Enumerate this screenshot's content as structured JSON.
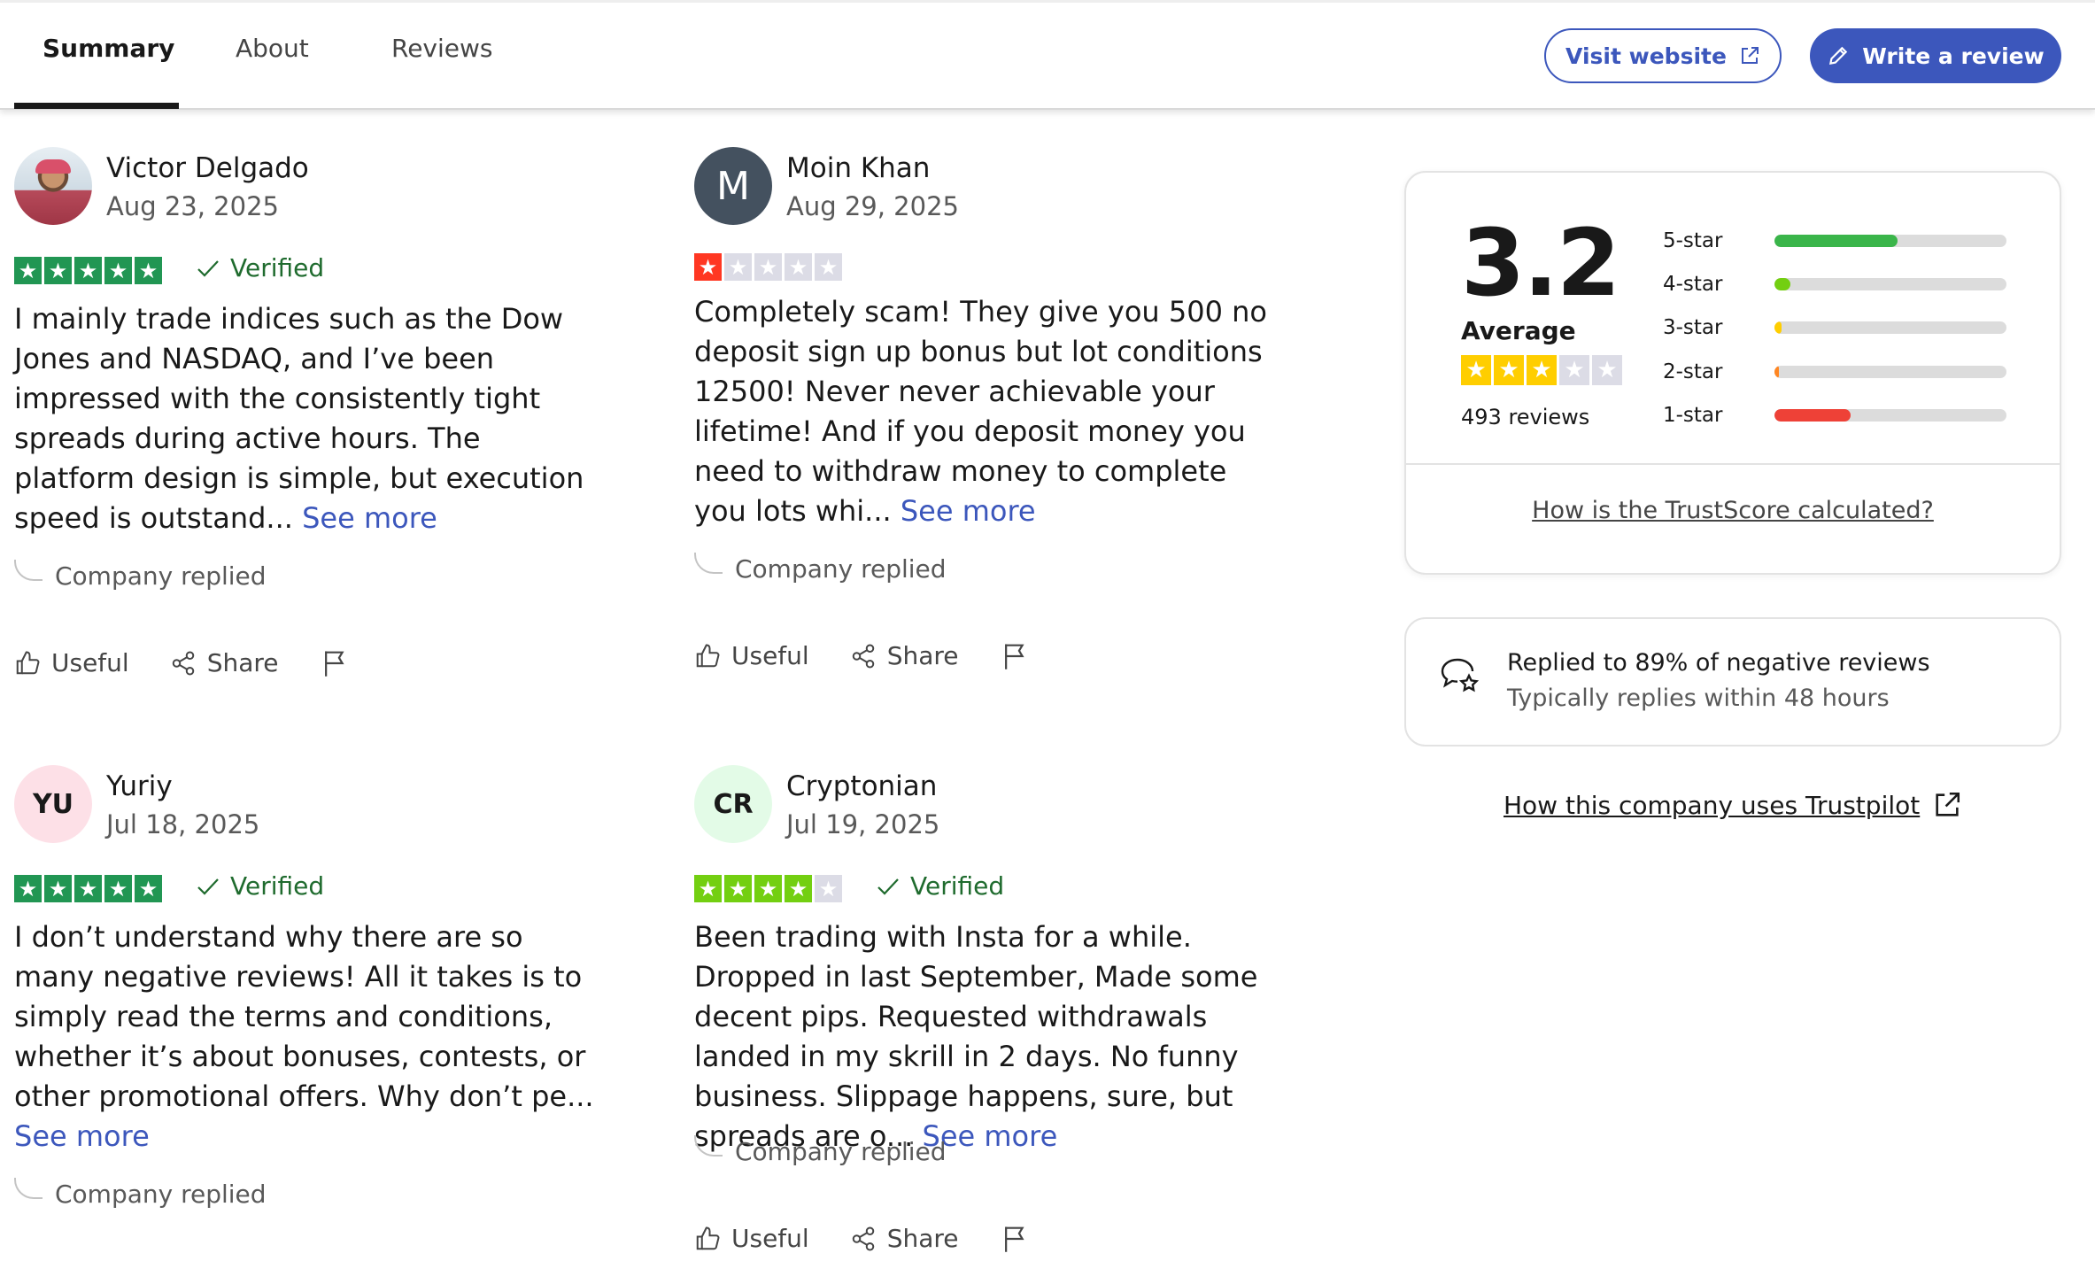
{
  "tabs": [
    {
      "label": "Summary",
      "active": true
    },
    {
      "label": "About",
      "active": false
    },
    {
      "label": "Reviews",
      "active": false
    }
  ],
  "header_buttons": {
    "visit_website": "Visit website",
    "write_review": "Write a review"
  },
  "colors": {
    "brand_blue": "#3c57bc",
    "star_green": "#219653",
    "star_lightgreen": "#73cf11",
    "star_yellow": "#ffce00",
    "star_orange": "#ff8622",
    "star_red": "#ff3722",
    "star_empty": "#dcdce6"
  },
  "reviews": [
    {
      "name": "Victor Delgado",
      "date": "Aug 23, 2025",
      "avatar": {
        "type": "photo",
        "text": ""
      },
      "rating": 5,
      "verified": "Verified",
      "text": "I mainly trade indices such as the Dow Jones and NASDAQ, and I’ve been impressed with the consistently tight spreads during active hours. The platform design is simple, but execution speed is outstand...",
      "see_more": "See more",
      "company_replied": "Company replied",
      "useful": "Useful",
      "share": "Share"
    },
    {
      "name": "Moin Khan",
      "date": "Aug 29, 2025",
      "avatar": {
        "type": "letter",
        "text": "M"
      },
      "rating": 1,
      "verified": "",
      "text": "Completely scam! They give you 500 no deposit sign up bonus but lot conditions 12500! Never never achievable your lifetime! And if you deposit money you need to withdraw money to complete you lots whi...",
      "see_more": "See more",
      "company_replied": "Company replied",
      "useful": "Useful",
      "share": "Share"
    },
    {
      "name": "Yuriy",
      "date": "Jul 18, 2025",
      "avatar": {
        "type": "initials",
        "text": "YU"
      },
      "rating": 5,
      "verified": "Verified",
      "text": "I don’t understand why there are so many negative reviews! All it takes is to simply read the terms and conditions, whether it’s about bonuses, contests, or other promotional offers. Why don’t pe...",
      "see_more": "See more",
      "company_replied": "Company replied",
      "useful": "Useful",
      "share": "Share"
    },
    {
      "name": "Cryptonian",
      "date": "Jul 19, 2025",
      "avatar": {
        "type": "initials",
        "text": "CR"
      },
      "rating": 4,
      "verified": "Verified",
      "text": "Been trading with Insta for a while. Dropped in last September, Made some decent pips. Requested withdrawals landed in my skrill in 2 days. No funny business. Slippage happens, sure, but spreads are o...",
      "see_more": "See more",
      "company_replied": "Company replied",
      "useful": "Useful",
      "share": "Share"
    }
  ],
  "trustscore": {
    "score": "3.2",
    "label": "Average",
    "rating_stars": 3,
    "reviews_count": "493 reviews",
    "distribution": [
      {
        "label": "5-star",
        "fraction": 0.53,
        "color": "#3ab54a"
      },
      {
        "label": "4-star",
        "fraction": 0.07,
        "color": "#73cf11"
      },
      {
        "label": "3-star",
        "fraction": 0.03,
        "color": "#ffce00"
      },
      {
        "label": "2-star",
        "fraction": 0.02,
        "color": "#ff8622"
      },
      {
        "label": "1-star",
        "fraction": 0.33,
        "color": "#ee4137"
      }
    ],
    "how_calculated": "How is the TrustScore calculated?"
  },
  "reply_stats": {
    "title": "Replied to 89% of negative reviews",
    "subtitle": "Typically replies within 48 hours"
  },
  "company_link": "How this company uses Trustpilot"
}
